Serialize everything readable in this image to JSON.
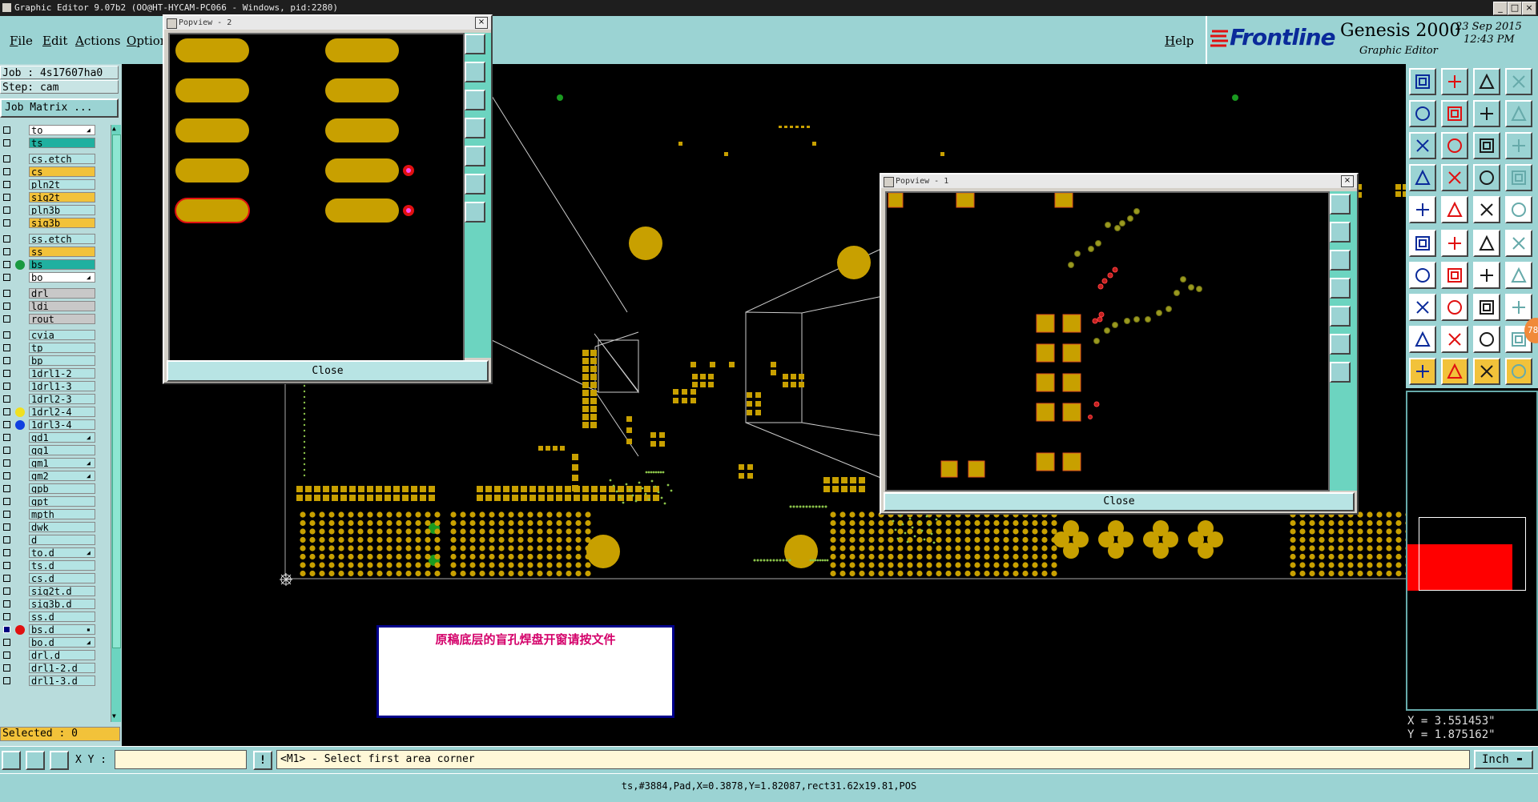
{
  "window": {
    "title": "Graphic Editor 9.07b2 (OO@HT-HYCAM-PC066 - Windows, pid:2280)",
    "minimize": "_",
    "maximize": "□",
    "close": "×"
  },
  "menu": {
    "file": "File",
    "edit": "Edit",
    "actions": "Actions",
    "options": "Option",
    "help": "Help"
  },
  "brand": {
    "logo": "Frontline",
    "product": "Genesis 2000",
    "subtitle": "Graphic Editor",
    "date": "23 Sep 2015",
    "time": "12:43 PM"
  },
  "job": {
    "job_line": "Job : 4s17607ha0",
    "step_line": "Step: cam",
    "matrix_button": "Job Matrix ..."
  },
  "layers": [
    {
      "name": "to",
      "color": "#ffffff",
      "flag": "◢"
    },
    {
      "name": "ts",
      "color": "#20b0a0",
      "flag": ""
    },
    {
      "name": "cs.etch",
      "color": "#b4e4e4",
      "flag": ""
    },
    {
      "name": "cs",
      "color": "#f2c23a",
      "flag": ""
    },
    {
      "name": "pln2t",
      "color": "#b4e4e4",
      "flag": ""
    },
    {
      "name": "sig2t",
      "color": "#f2c23a",
      "flag": ""
    },
    {
      "name": "pln3b",
      "color": "#b4e4e4",
      "flag": ""
    },
    {
      "name": "sig3b",
      "color": "#f2c23a",
      "flag": ""
    },
    {
      "name": "ss.etch",
      "color": "#b4e4e4",
      "flag": ""
    },
    {
      "name": "ss",
      "color": "#f2c23a",
      "flag": ""
    },
    {
      "name": "bs",
      "color": "#20b0a0",
      "flag": "",
      "dot": "#1a9a40"
    },
    {
      "name": "bo",
      "color": "#ffffff",
      "flag": "◢"
    },
    {
      "name": "drl",
      "color": "#c8c8c8",
      "flag": ""
    },
    {
      "name": "ldi",
      "color": "#c8c8c8",
      "flag": ""
    },
    {
      "name": "rout",
      "color": "#c8c8c8",
      "flag": ""
    },
    {
      "name": "cvia",
      "color": "#b4e4e4",
      "flag": ""
    },
    {
      "name": "tp",
      "color": "#b4e4e4",
      "flag": ""
    },
    {
      "name": "bp",
      "color": "#b4e4e4",
      "flag": ""
    },
    {
      "name": "1drl1-2",
      "color": "#b4e4e4",
      "flag": ""
    },
    {
      "name": "1drl1-3",
      "color": "#b4e4e4",
      "flag": ""
    },
    {
      "name": "1drl2-3",
      "color": "#b4e4e4",
      "flag": ""
    },
    {
      "name": "1drl2-4",
      "color": "#b4e4e4",
      "flag": "",
      "dot": "#f0e020"
    },
    {
      "name": "1drl3-4",
      "color": "#b4e4e4",
      "flag": "",
      "dot": "#1040e0"
    },
    {
      "name": "gd1",
      "color": "#b4e4e4",
      "flag": "◢"
    },
    {
      "name": "gg1",
      "color": "#b4e4e4",
      "flag": ""
    },
    {
      "name": "gm1",
      "color": "#b4e4e4",
      "flag": "◢"
    },
    {
      "name": "gm2",
      "color": "#b4e4e4",
      "flag": "◢"
    },
    {
      "name": "gpb",
      "color": "#b4e4e4",
      "flag": ""
    },
    {
      "name": "gpt",
      "color": "#b4e4e4",
      "flag": ""
    },
    {
      "name": "mpth",
      "color": "#b4e4e4",
      "flag": ""
    },
    {
      "name": "dwk",
      "color": "#b4e4e4",
      "flag": ""
    },
    {
      "name": "d",
      "color": "#b4e4e4",
      "flag": ""
    },
    {
      "name": "to.d",
      "color": "#b4e4e4",
      "flag": "◢"
    },
    {
      "name": "ts.d",
      "color": "#b4e4e4",
      "flag": ""
    },
    {
      "name": "cs.d",
      "color": "#b4e4e4",
      "flag": ""
    },
    {
      "name": "sig2t.d",
      "color": "#b4e4e4",
      "flag": ""
    },
    {
      "name": "sig3b.d",
      "color": "#b4e4e4",
      "flag": ""
    },
    {
      "name": "ss.d",
      "color": "#b4e4e4",
      "flag": ""
    },
    {
      "name": "bs.d",
      "color": "#b4e4e4",
      "flag": "▪",
      "dot": "#e01010",
      "selected": true
    },
    {
      "name": "bo.d",
      "color": "#b4e4e4",
      "flag": "◢"
    },
    {
      "name": "drl.d",
      "color": "#b4e4e4",
      "flag": ""
    },
    {
      "name": "drl1-2.d",
      "color": "#b4e4e4",
      "flag": ""
    },
    {
      "name": "drl1-3.d",
      "color": "#b4e4e4",
      "flag": ""
    }
  ],
  "selected": "Selected : 0",
  "popview2": {
    "title": "Popview - 2",
    "close": "Close",
    "close_x": "×"
  },
  "popview1": {
    "title": "Popview - 1",
    "close": "Close",
    "close_x": "×"
  },
  "annotation": "原稿底层的盲孔焊盘开窗请按文件",
  "coords": {
    "x": "X = 3.551453\"",
    "y": "Y = 1.875162\""
  },
  "command": {
    "xy_label": "X Y :",
    "xy_value": "",
    "alert": "!",
    "prompt": "<M1> - Select first area corner",
    "units": "Inch"
  },
  "status": "ts,#3884,Pad,X=0.3878,Y=1.82087,rect31.62x19.81,POS",
  "badge": "78",
  "colors": {
    "pad": "#c8a000",
    "green_pad": "#1a9a20",
    "red_pad": "#e01010",
    "panel": "#9bd3d3"
  }
}
